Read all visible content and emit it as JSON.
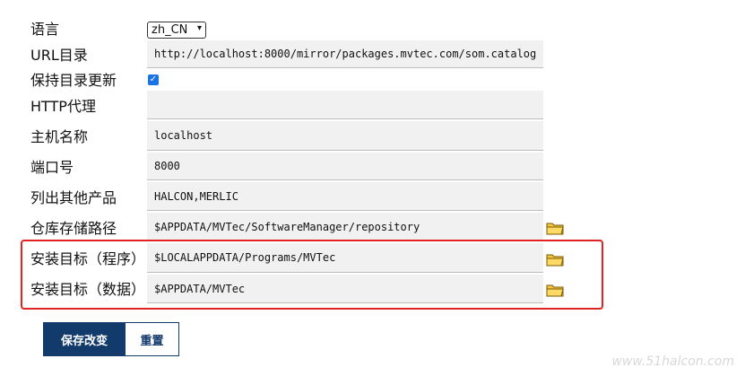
{
  "form": {
    "language": {
      "label": "语言",
      "selected": "zh_CN"
    },
    "url_catalog": {
      "label": "URL目录",
      "value": "http://localhost:8000/mirror/packages.mvtec.com/som.catalog"
    },
    "keep_catalog_updated": {
      "label": "保持目录更新",
      "checked": true
    },
    "http_proxy": {
      "label": "HTTP代理",
      "value": ""
    },
    "host_name": {
      "label": "主机名称",
      "value": "localhost"
    },
    "port": {
      "label": "端口号",
      "value": "8000"
    },
    "list_other_products": {
      "label": "列出其他产品",
      "value": "HALCON,MERLIC"
    },
    "repository_path": {
      "label": "仓库存储路径",
      "value": "$APPDATA/MVTec/SoftwareManager/repository"
    },
    "install_target_program": {
      "label": "安装目标（程序）",
      "value": "$LOCALAPPDATA/Programs/MVTec"
    },
    "install_target_data": {
      "label": "安装目标（数据）",
      "value": "$APPDATA/MVTec"
    }
  },
  "buttons": {
    "save": "保存改变",
    "reset": "重置"
  },
  "icons": {
    "folder": "folder-icon",
    "checkmark": "checkmark-icon"
  },
  "colors": {
    "primary": "#123a6b",
    "highlight": "#e02424",
    "checkbox": "#1a73e8"
  },
  "watermark": "www.51halcon.com"
}
